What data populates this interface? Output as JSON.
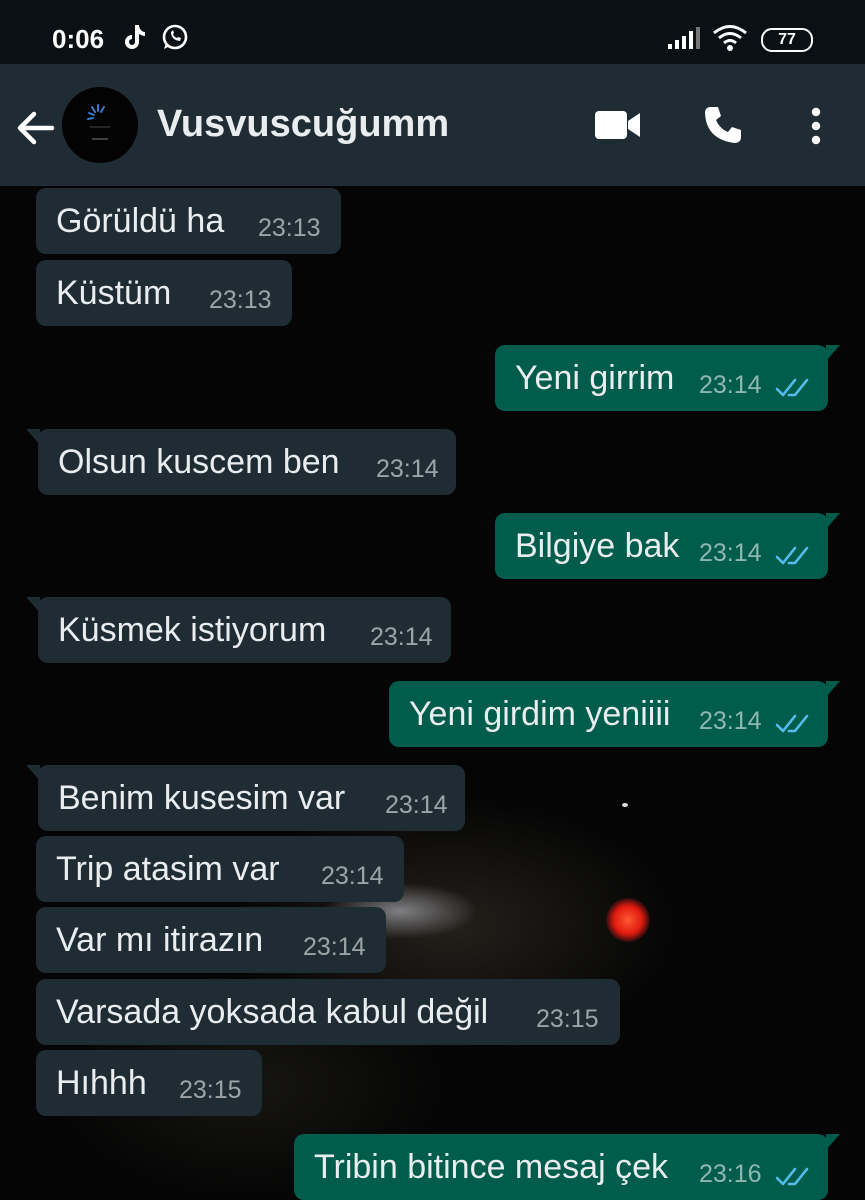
{
  "status_bar": {
    "time": "0:06",
    "icons": [
      "tiktok-icon",
      "whatsapp-icon",
      "signal-icon",
      "wifi-icon",
      "battery-icon"
    ],
    "battery": "77"
  },
  "header": {
    "contact_name": "Vusvuscuğumm",
    "icons": [
      "back-arrow-icon",
      "video-call-icon",
      "phone-icon",
      "more-vert-icon"
    ]
  },
  "colors": {
    "header_bg": "#1f2c33",
    "incoming_bubble": "#1f2c33",
    "outgoing_bubble": "#005c4b",
    "read_ticks": "#53bdeb"
  },
  "messages": [
    {
      "direction": "in",
      "text": "Görüldü ha",
      "time": "23:13"
    },
    {
      "direction": "in",
      "text": "Küstüm",
      "time": "23:13"
    },
    {
      "direction": "out",
      "text": "Yeni girrim",
      "time": "23:14",
      "status": "read"
    },
    {
      "direction": "in",
      "text": "Olsun kuscem ben",
      "time": "23:14"
    },
    {
      "direction": "out",
      "text": "Bilgiye bak",
      "time": "23:14",
      "status": "read"
    },
    {
      "direction": "in",
      "text": "Küsmek istiyorum",
      "time": "23:14"
    },
    {
      "direction": "out",
      "text": "Yeni girdim yeniiii",
      "time": "23:14",
      "status": "read"
    },
    {
      "direction": "in",
      "text": "Benim kusesim var",
      "time": "23:14"
    },
    {
      "direction": "in",
      "text": "Trip atasim var",
      "time": "23:14"
    },
    {
      "direction": "in",
      "text": "Var mı itirazın",
      "time": "23:14"
    },
    {
      "direction": "in",
      "text": "Varsada yoksada kabul değil",
      "time": "23:15"
    },
    {
      "direction": "in",
      "text": "Hıhhh",
      "time": "23:15"
    },
    {
      "direction": "out",
      "text": "Tribin bitince mesaj çek",
      "time": "23:16",
      "status": "read"
    }
  ]
}
